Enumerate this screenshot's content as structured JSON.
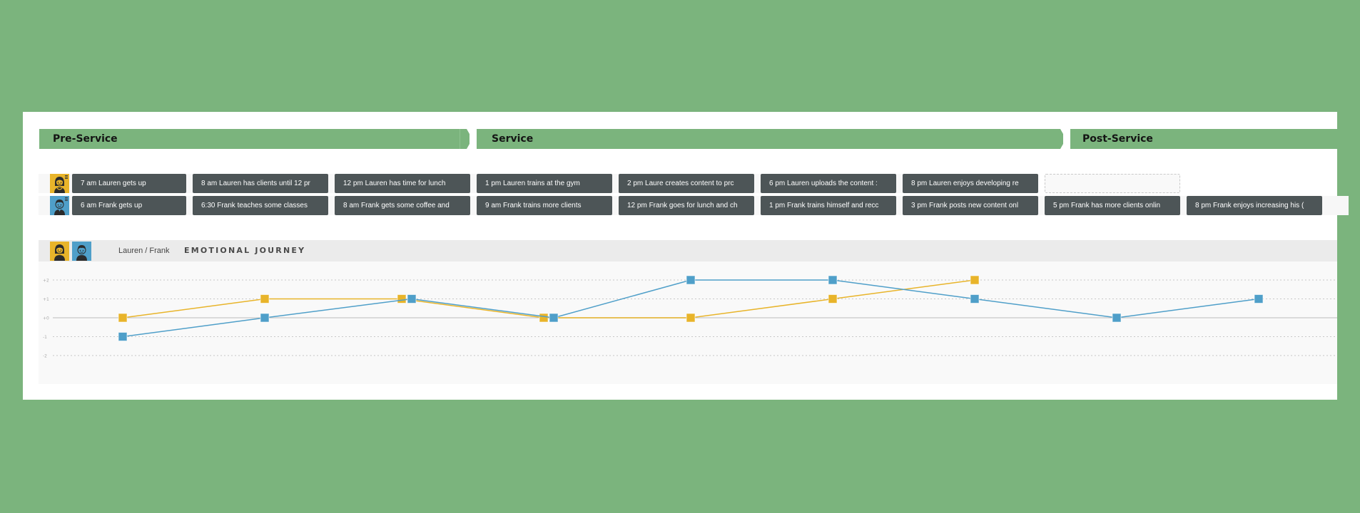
{
  "phases": [
    {
      "label": "Pre-Service"
    },
    {
      "label": "Service"
    },
    {
      "label": "Post-Service"
    }
  ],
  "personas": [
    {
      "name": "Lauren",
      "color": "#e8b42a",
      "icon": "woman-avatar-icon"
    },
    {
      "name": "Frank",
      "color": "#4f9fc9",
      "icon": "man-avatar-icon"
    }
  ],
  "steps": {
    "lauren": [
      "7 am Lauren gets up",
      "8 am Lauren has clients until 12 pr",
      "12 pm Lauren has time for lunch",
      "1 pm Lauren trains at the gym",
      "2 pm Laure creates content to prc",
      "6 pm Lauren uploads the content :",
      "8 pm Lauren enjoys developing re",
      ""
    ],
    "frank": [
      "6 am Frank gets up",
      "6:30 Frank teaches some classes",
      "8 am Frank gets some coffee and",
      "9 am Frank trains more clients",
      "12 pm Frank goes for lunch and ch",
      "1 pm Frank trains himself and recc",
      "3 pm Frank posts new content onl",
      "5 pm Frank has more clients onlin",
      "8 pm Frank enjoys increasing his ("
    ]
  },
  "emotional_journey": {
    "names_label": "Lauren / Frank",
    "title": "EMOTIONAL JOURNEY"
  },
  "chart_data": {
    "type": "line",
    "title": "EMOTIONAL JOURNEY",
    "xlabel": "",
    "ylabel": "",
    "y_ticks": [
      "+2",
      "+1",
      "+0",
      "-1",
      "-2"
    ],
    "ylim": [
      -2,
      2
    ],
    "grid": true,
    "series": [
      {
        "name": "Lauren",
        "color": "#e8b42a",
        "step_index": [
          0,
          1,
          2,
          3,
          4,
          5,
          6
        ],
        "values": [
          0,
          1,
          1,
          0,
          0,
          1,
          2
        ]
      },
      {
        "name": "Frank",
        "color": "#4f9fc9",
        "step_index": [
          0,
          1,
          2,
          3,
          4,
          5,
          6,
          7,
          8
        ],
        "values": [
          -1,
          0,
          1,
          0,
          2,
          2,
          1,
          0,
          1
        ]
      }
    ]
  }
}
